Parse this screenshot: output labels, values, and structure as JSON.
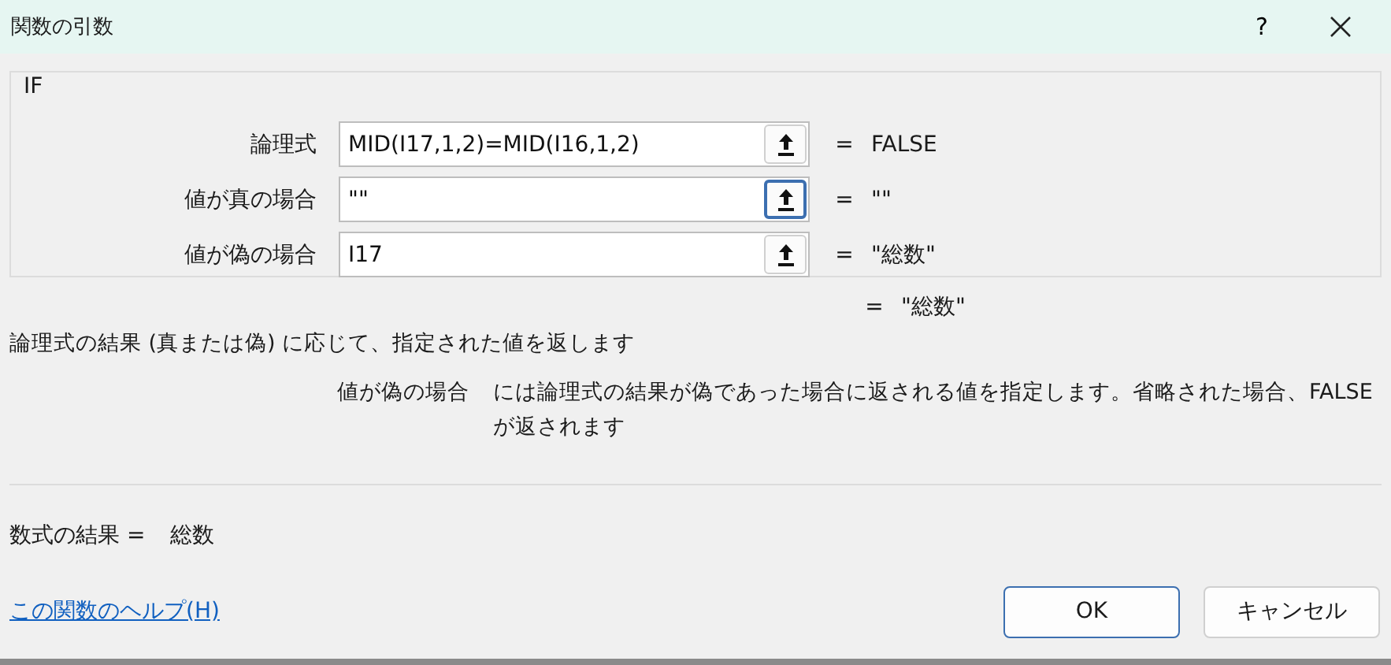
{
  "window": {
    "title": "関数の引数",
    "help_button": "?"
  },
  "function_name": "IF",
  "arguments": [
    {
      "label": "論理式",
      "value": "MID(I17,1,2)=MID(I16,1,2)",
      "equals": "=",
      "result": "FALSE",
      "focused": false
    },
    {
      "label": "値が真の場合",
      "value": "\"\"",
      "equals": "=",
      "result": "\"\"",
      "focused": true
    },
    {
      "label": "値が偽の場合",
      "value": "I17",
      "equals": "=",
      "result": "\"総数\"",
      "focused": false
    }
  ],
  "overall_result": {
    "equals": "=",
    "value": "\"総数\""
  },
  "description": "論理式の結果 (真または偽) に応じて、指定された値を返します",
  "argument_help": {
    "label": "値が偽の場合",
    "text": "には論理式の結果が偽であった場合に返される値を指定します。省略された場合、FALSE が返されます"
  },
  "formula_result": {
    "label": "数式の結果 =",
    "value": "総数"
  },
  "help_link": "この関数のヘルプ(H)",
  "buttons": [
    {
      "label": "OK",
      "default": true
    },
    {
      "label": "キャンセル",
      "default": false
    }
  ]
}
